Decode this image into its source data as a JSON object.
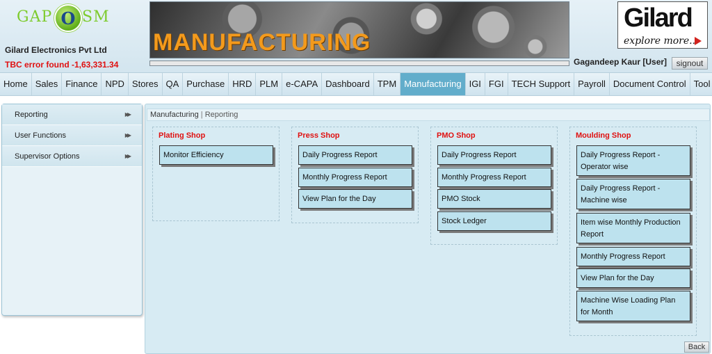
{
  "logo": {
    "left_text": "GAP",
    "center_text": "O",
    "right_text": "SM"
  },
  "header": {
    "company": "Gilard Electronics Pvt Ltd",
    "tbc_error": "TBC error found -1,63,331.34",
    "banner_title": "MANUFACTURING",
    "brand_name": "Gilard",
    "brand_tagline": "explore more...",
    "user": "Gagandeep Kaur [User]",
    "signout_label": "signout"
  },
  "nav": {
    "items": [
      "Home",
      "Sales",
      "Finance",
      "NPD",
      "Stores",
      "QA",
      "Purchase",
      "HRD",
      "PLM",
      "e-CAPA",
      "Dashboard",
      "TPM",
      "Manufacturing",
      "IGI",
      "FGI",
      "TECH Support",
      "Payroll",
      "Document Control",
      "Tool Room"
    ],
    "active": "Manufacturing"
  },
  "sidebar": {
    "items": [
      {
        "label": "Reporting",
        "icon": "double-chevron-right-icon"
      },
      {
        "label": "User Functions",
        "icon": "double-chevron-right-icon"
      },
      {
        "label": "Supervisor Options",
        "icon": "double-chevron-right-icon"
      }
    ]
  },
  "breadcrumb": {
    "section": "Manufacturing",
    "separator": "|",
    "current": "Reporting"
  },
  "groups": [
    {
      "title": "Plating Shop",
      "buttons": [
        "Monitor Efficiency"
      ]
    },
    {
      "title": "Press Shop",
      "buttons": [
        "Daily Progress Report",
        "Monthly Progress Report",
        "View Plan for the Day"
      ]
    },
    {
      "title": "PMO Shop",
      "buttons": [
        "Daily Progress Report",
        "Monthly Progress Report",
        "PMO Stock",
        "Stock Ledger"
      ]
    },
    {
      "title": "Moulding Shop",
      "buttons": [
        "Daily Progress Report - Operator wise",
        "Daily Progress Report - Machine wise",
        "Item wise Monthly Production Report",
        "Monthly Progress Report",
        "View Plan for the Day",
        "Machine Wise Loading Plan for Month"
      ]
    }
  ],
  "back_label": "Back",
  "colors": {
    "accent": "#62adcb",
    "error": "#e01010",
    "button_bg": "#bde2ee"
  }
}
